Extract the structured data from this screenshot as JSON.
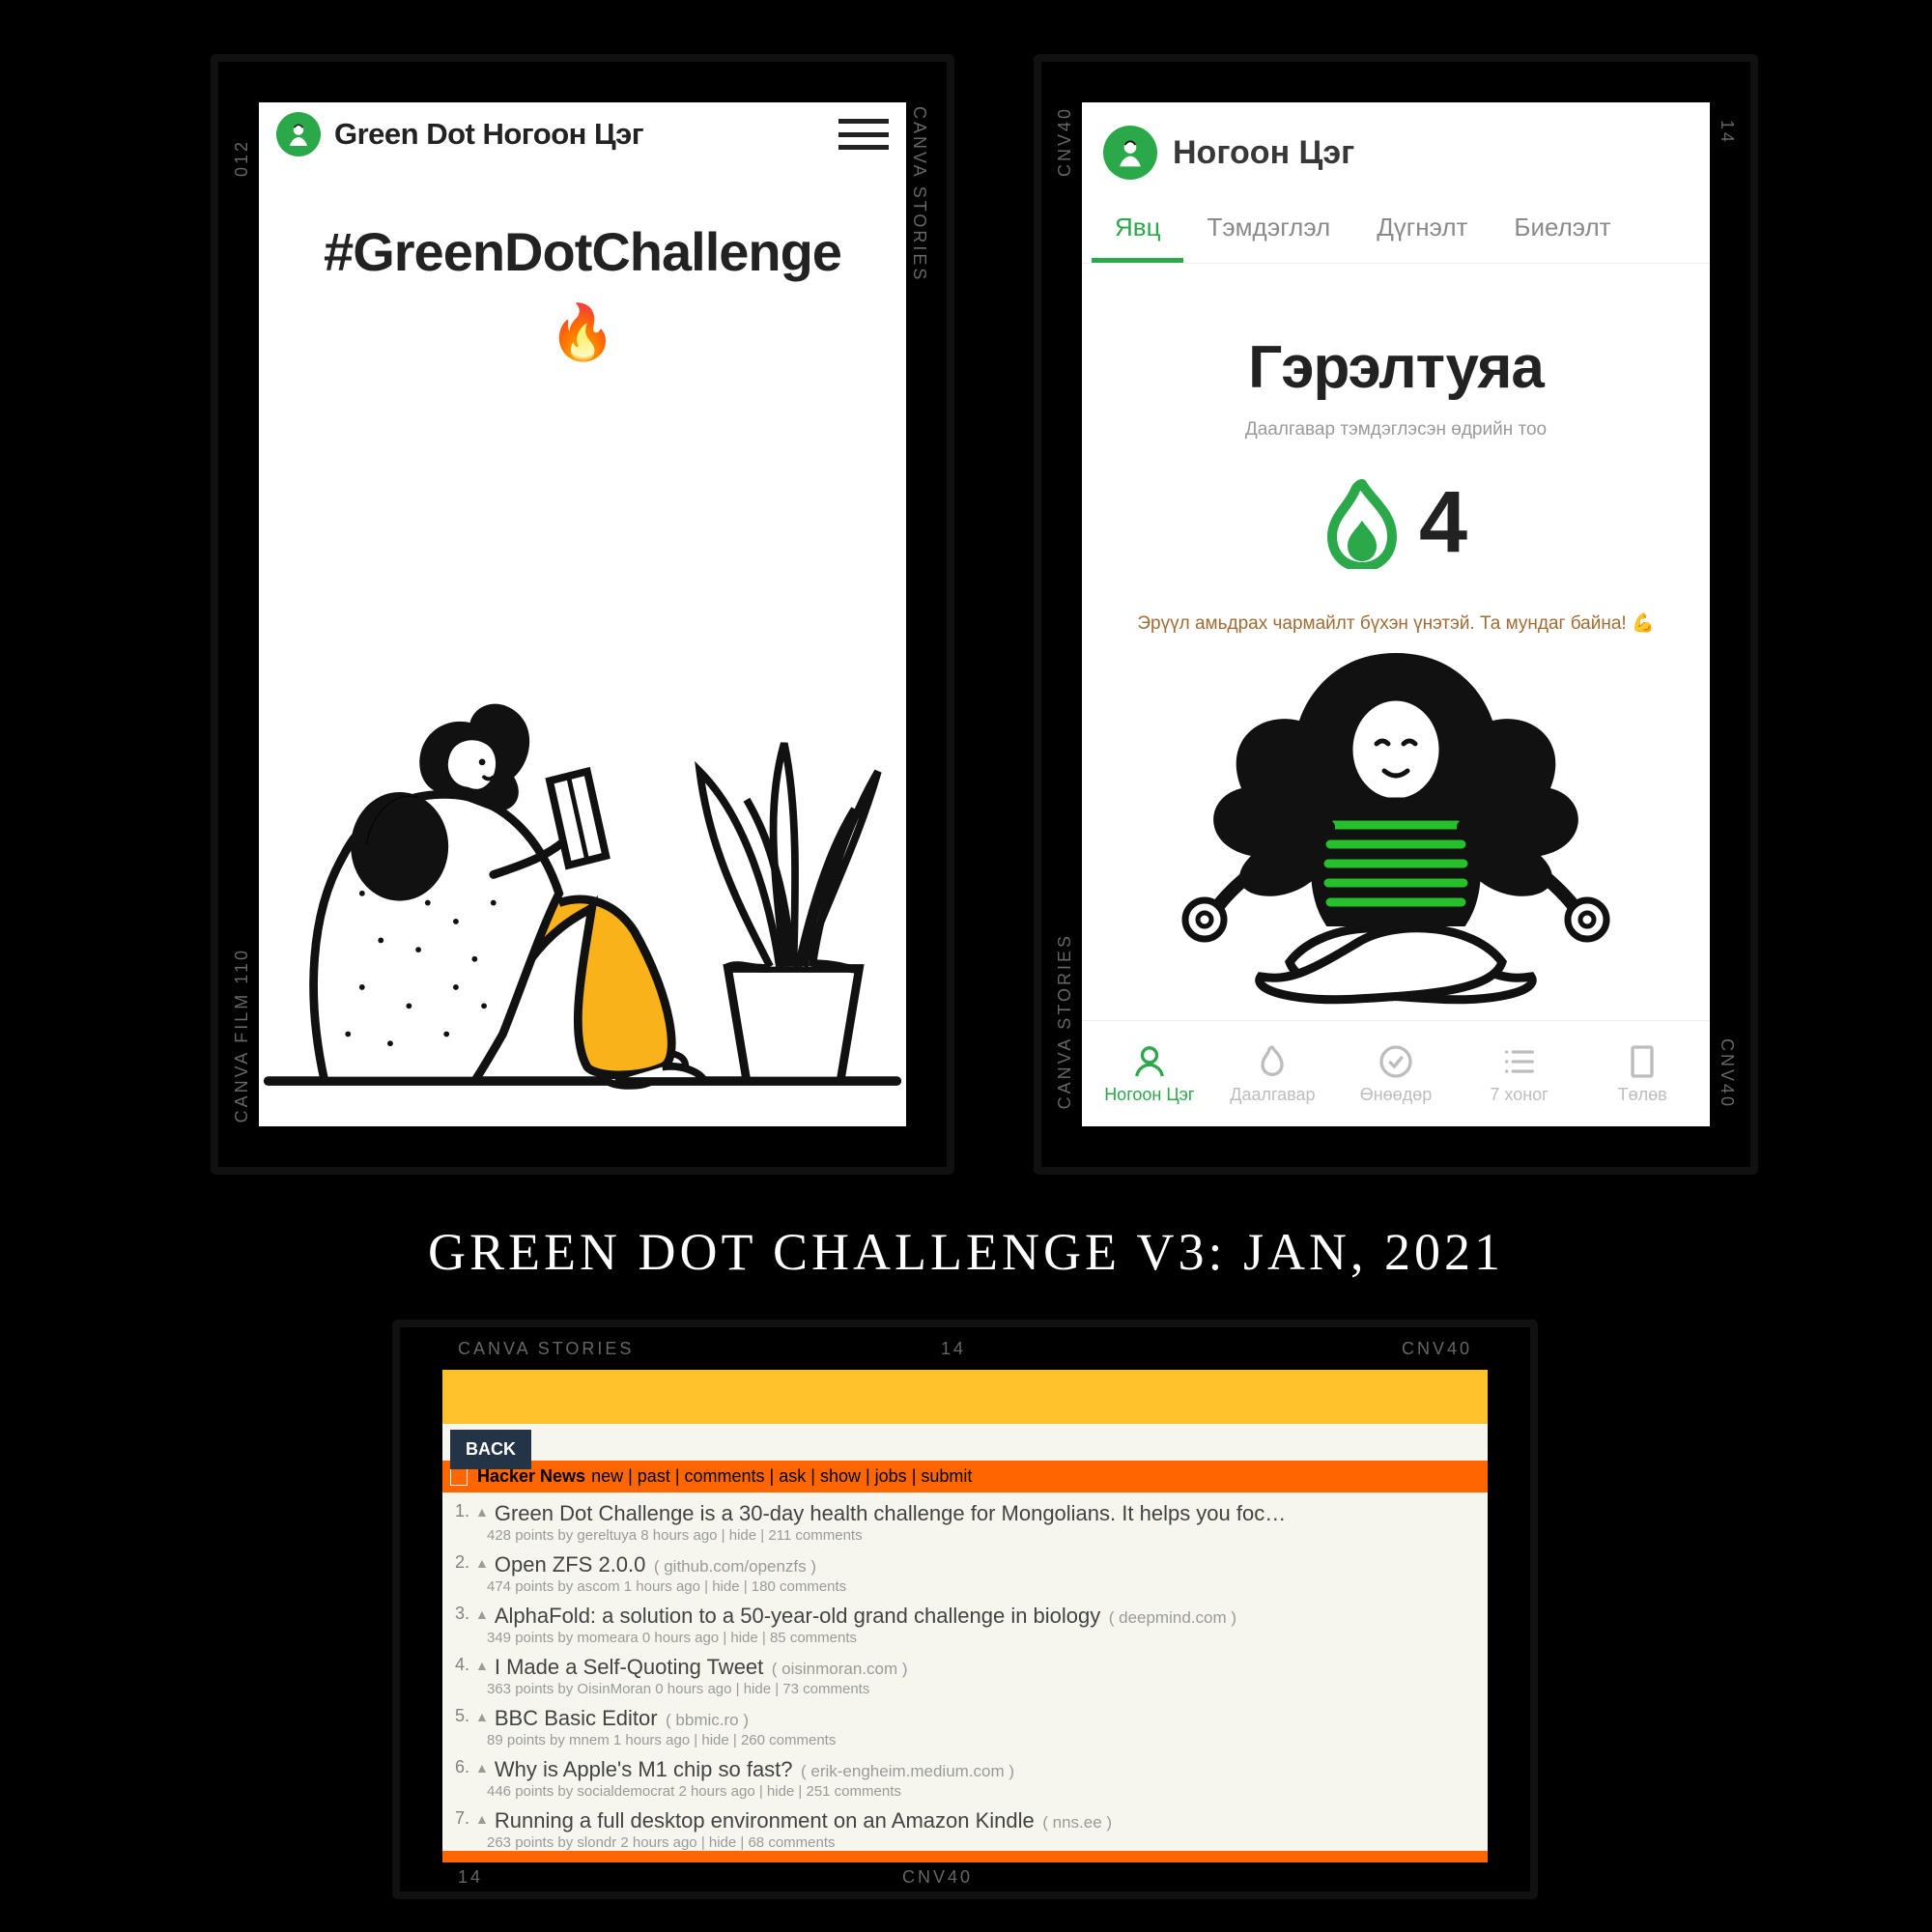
{
  "collage_title": "GREEN DOT CHALLENGE V3: JAN, 2021",
  "film_labels": {
    "canva_stories": "CANVA STORIES",
    "canva_film": "CANVA FILM 110",
    "cnv40": "CNV40",
    "n14": "14",
    "n012": "012"
  },
  "screen1": {
    "brand": "Green Dot Ногоон Цэг",
    "hashtag": "#GreenDotChallenge",
    "fire": "🔥"
  },
  "screen2": {
    "brand": "Ногоон Цэг",
    "tabs": [
      "Явц",
      "Тэмдэглэл",
      "Дүгнэлт",
      "Биелэлт"
    ],
    "active_tab": 0,
    "user_name": "Гэрэлтуяа",
    "subtitle": "Даалгавар тэмдэглэсэн өдрийн тоо",
    "streak_count": "4",
    "message": "Эрүүл амьдрах чармайлт бүхэн үнэтэй. Та мундаг байна! 💪",
    "bottom_nav": [
      {
        "label": "Ногоон Цэг",
        "active": true,
        "icon": "user"
      },
      {
        "label": "Даалгавар",
        "active": false,
        "icon": "flame"
      },
      {
        "label": "Өнөөдөр",
        "active": false,
        "icon": "check"
      },
      {
        "label": "7 хоног",
        "active": false,
        "icon": "list"
      },
      {
        "label": "Төлөв",
        "active": false,
        "icon": "doc"
      }
    ]
  },
  "hn": {
    "back_label": "BACK",
    "site": "Hacker News",
    "nav": [
      "new",
      "past",
      "comments",
      "ask",
      "show",
      "jobs",
      "submit"
    ],
    "items": [
      {
        "rank": "1.",
        "title": "Green Dot Challenge is a 30-day health challenge for Mongolians. It helps you foc…",
        "domain": "",
        "meta": "428 points by gereltuya 8 hours ago | hide | 211 comments"
      },
      {
        "rank": "2.",
        "title": "Open ZFS 2.0.0",
        "domain": "( github.com/openzfs )",
        "meta": "474 points by ascom 1 hours ago | hide | 180 comments"
      },
      {
        "rank": "3.",
        "title": "AlphaFold: a solution to a 50-year-old grand challenge in biology",
        "domain": "( deepmind.com )",
        "meta": "349 points by momeara 0 hours ago | hide | 85 comments"
      },
      {
        "rank": "4.",
        "title": "I Made a Self-Quoting Tweet",
        "domain": "( oisinmoran.com )",
        "meta": "363 points by OisinMoran 0 hours ago | hide | 73 comments"
      },
      {
        "rank": "5.",
        "title": "BBC Basic Editor",
        "domain": "( bbmic.ro )",
        "meta": "89 points by mnem 1 hours ago | hide | 260 comments"
      },
      {
        "rank": "6.",
        "title": "Why is Apple's M1 chip so fast?",
        "domain": "( erik-engheim.medium.com )",
        "meta": "446 points by socialdemocrat 2 hours ago | hide | 251 comments"
      },
      {
        "rank": "7.",
        "title": "Running a full desktop environment on an Amazon Kindle",
        "domain": "( nns.ee )",
        "meta": "263 points by slondr 2 hours ago | hide | 68 comments"
      }
    ]
  }
}
